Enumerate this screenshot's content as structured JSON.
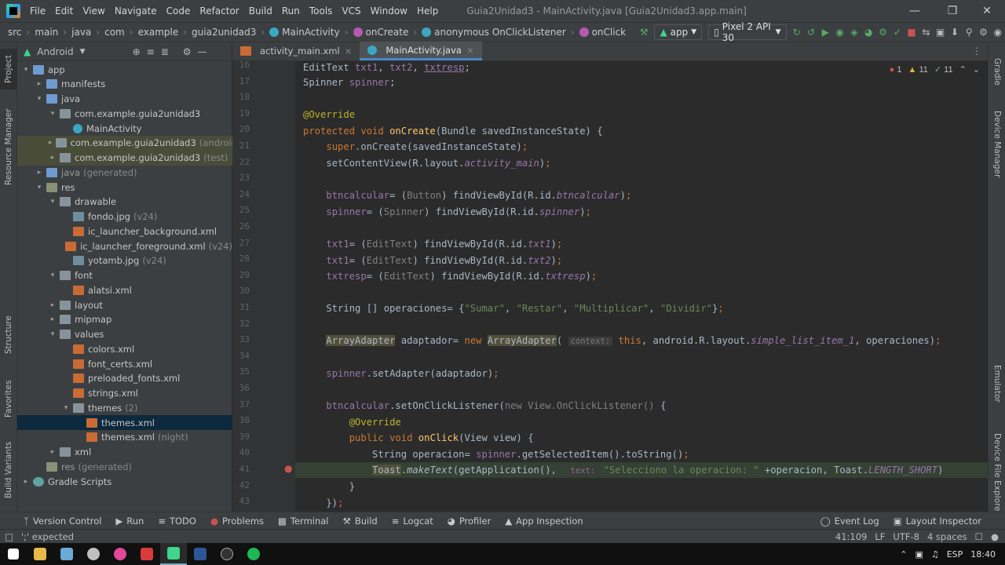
{
  "menubar": {
    "items": [
      "File",
      "Edit",
      "View",
      "Navigate",
      "Code",
      "Refactor",
      "Build",
      "Run",
      "Tools",
      "VCS",
      "Window",
      "Help"
    ],
    "title": "Guia2Unidad3 - MainActivity.java [Guia2Unidad3.app.main]"
  },
  "navbar": {
    "crumbs": [
      "src",
      "main",
      "java",
      "com",
      "example",
      "guia2unidad3",
      "MainActivity",
      "onCreate",
      "anonymous OnClickListener",
      "onClick"
    ],
    "run_config": "app",
    "device": "Pixel 2 API 30"
  },
  "project": {
    "view_label": "Android",
    "tree": [
      {
        "label": "app",
        "depth": 0,
        "arrow": "▾",
        "icon": "folder blue"
      },
      {
        "label": "manifests",
        "depth": 1,
        "arrow": "▸",
        "icon": "folder blue"
      },
      {
        "label": "java",
        "depth": 1,
        "arrow": "▾",
        "icon": "folder blue"
      },
      {
        "label": "com.example.guia2unidad3",
        "depth": 2,
        "arrow": "▾",
        "icon": "folder"
      },
      {
        "label": "MainActivity",
        "depth": 3,
        "arrow": "",
        "icon": "classicon"
      },
      {
        "label": "com.example.guia2unidad3",
        "extra": "(androidTest)",
        "depth": 2,
        "arrow": "▸",
        "icon": "folder",
        "hl": true
      },
      {
        "label": "com.example.guia2unidad3",
        "extra": "(test)",
        "depth": 2,
        "arrow": "▸",
        "icon": "folder",
        "hl": true
      },
      {
        "label": "java",
        "extra": "(generated)",
        "depth": 1,
        "arrow": "▸",
        "icon": "folder blue",
        "dimlabel": true
      },
      {
        "label": "res",
        "depth": 1,
        "arrow": "▾",
        "icon": "folder res"
      },
      {
        "label": "drawable",
        "depth": 2,
        "arrow": "▾",
        "icon": "folder"
      },
      {
        "label": "fondo.jpg",
        "extra": "(v24)",
        "depth": 3,
        "arrow": "",
        "icon": "imgicon"
      },
      {
        "label": "ic_launcher_background.xml",
        "depth": 3,
        "arrow": "",
        "icon": "xmlicon"
      },
      {
        "label": "ic_launcher_foreground.xml",
        "extra": "(v24)",
        "depth": 3,
        "arrow": "",
        "icon": "xmlicon"
      },
      {
        "label": "yotamb.jpg",
        "extra": "(v24)",
        "depth": 3,
        "arrow": "",
        "icon": "imgicon"
      },
      {
        "label": "font",
        "depth": 2,
        "arrow": "▾",
        "icon": "folder"
      },
      {
        "label": "alatsi.xml",
        "depth": 3,
        "arrow": "",
        "icon": "xmlicon"
      },
      {
        "label": "layout",
        "depth": 2,
        "arrow": "▸",
        "icon": "folder"
      },
      {
        "label": "mipmap",
        "depth": 2,
        "arrow": "▸",
        "icon": "folder"
      },
      {
        "label": "values",
        "depth": 2,
        "arrow": "▾",
        "icon": "folder"
      },
      {
        "label": "colors.xml",
        "depth": 3,
        "arrow": "",
        "icon": "xmlicon"
      },
      {
        "label": "font_certs.xml",
        "depth": 3,
        "arrow": "",
        "icon": "xmlicon"
      },
      {
        "label": "preloaded_fonts.xml",
        "depth": 3,
        "arrow": "",
        "icon": "xmlicon"
      },
      {
        "label": "strings.xml",
        "depth": 3,
        "arrow": "",
        "icon": "xmlicon"
      },
      {
        "label": "themes",
        "extra": "(2)",
        "depth": 3,
        "arrow": "▾",
        "icon": "folder"
      },
      {
        "label": "themes.xml",
        "depth": 4,
        "arrow": "",
        "icon": "xmlicon",
        "sel": true
      },
      {
        "label": "themes.xml",
        "extra": "(night)",
        "depth": 4,
        "arrow": "",
        "icon": "xmlicon"
      },
      {
        "label": "xml",
        "depth": 2,
        "arrow": "▸",
        "icon": "folder"
      },
      {
        "label": "res",
        "extra": "(generated)",
        "depth": 1,
        "arrow": "",
        "icon": "folder res",
        "dimlabel": true
      },
      {
        "label": "Gradle Scripts",
        "depth": 0,
        "arrow": "▸",
        "icon": "gradle"
      }
    ]
  },
  "tabs": [
    {
      "label": "activity_main.xml",
      "active": false
    },
    {
      "label": "MainActivity.java",
      "active": true
    }
  ],
  "inspections": {
    "errors": "1",
    "warnings": "11",
    "weak": "11"
  },
  "line_numbers": [
    "16",
    "17",
    "18",
    "19",
    "20",
    "21",
    "22",
    "23",
    "24",
    "25",
    "26",
    "27",
    "28",
    "29",
    "30",
    "31",
    "32",
    "33",
    "34",
    "35",
    "36",
    "37",
    "38",
    "39",
    "40",
    "41",
    "42",
    "43"
  ],
  "bottom_tools": [
    "Version Control",
    "Run",
    "TODO",
    "Problems",
    "Terminal",
    "Build",
    "Logcat",
    "Profiler",
    "App Inspection"
  ],
  "bottom_right": [
    "Event Log",
    "Layout Inspector"
  ],
  "status": {
    "message": "';' expected",
    "position": "41:109",
    "line_sep": "LF",
    "encoding": "UTF-8",
    "indent": "4 spaces"
  },
  "side_tabs": {
    "left": [
      "Project",
      "Resource Manager",
      "Structure",
      "Favorites",
      "Build Variants"
    ],
    "right": [
      "Gradle",
      "Device Manager",
      "Emulator",
      "Device File Explorer"
    ]
  },
  "taskbar": {
    "lang": "ESP",
    "time": "18:40"
  }
}
